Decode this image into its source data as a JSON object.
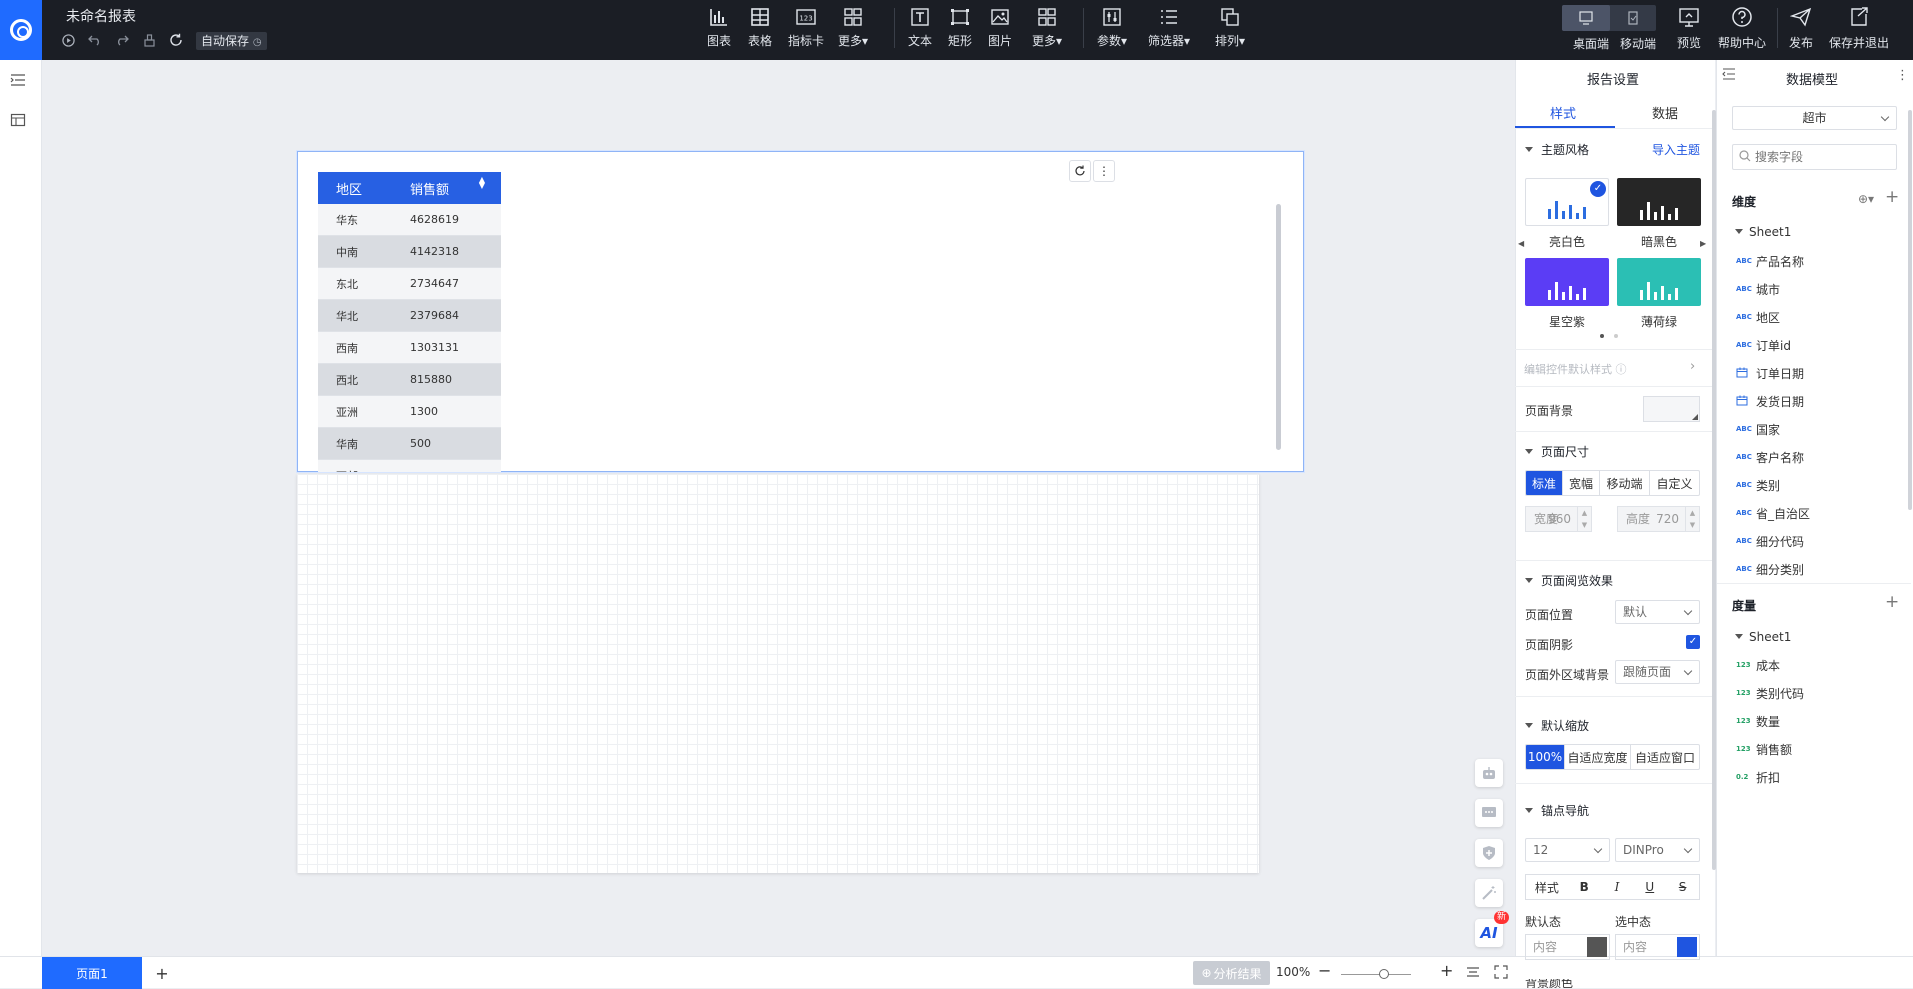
{
  "report_title": "未命名报表",
  "autosave_label": "自动保存",
  "toolbar": {
    "chart": "图表",
    "table": "表格",
    "kpi": "指标卡",
    "more1": "更多",
    "text": "文本",
    "rect": "矩形",
    "image": "图片",
    "more2": "更多",
    "param": "参数",
    "filter": "筛选器",
    "arrange": "排列",
    "kpi_icon_text": "123"
  },
  "right_toolbar": {
    "desktop": "桌面端",
    "mobile": "移动端",
    "preview": "预览",
    "help": "帮助中心",
    "publish": "发布",
    "save_exit": "保存并退出"
  },
  "table": {
    "headers": [
      "地区",
      "销售额"
    ],
    "rows": [
      [
        "华东",
        "4628619"
      ],
      [
        "中南",
        "4142318"
      ],
      [
        "东北",
        "2734647"
      ],
      [
        "华北",
        "2379684"
      ],
      [
        "西南",
        "1303131"
      ],
      [
        "西北",
        "815880"
      ],
      [
        "亚洲",
        "1300"
      ],
      [
        "华南",
        "500"
      ],
      [
        "西部",
        ""
      ]
    ]
  },
  "bottom": {
    "page_tab": "页面1",
    "add": "+",
    "analysis": "分析结果",
    "zoom": "100%",
    "zoom_minus": "−",
    "zoom_plus": "+"
  },
  "ai_badge": "新",
  "ai_label": "AI",
  "report_settings": {
    "title": "报告设置",
    "tab_style": "样式",
    "tab_data": "数据",
    "theme_section": "主题风格",
    "import_theme": "导入主题",
    "themes": [
      {
        "name": "亮白色",
        "color": "#ffffff",
        "bar": "#2c6de0"
      },
      {
        "name": "暗黑色",
        "color": "#262626",
        "bar": "#ffffff"
      },
      {
        "name": "星空紫",
        "color": "#5b3df5",
        "bar": "#ffffff"
      },
      {
        "name": "薄荷绿",
        "color": "#2bbfb4",
        "bar": "#ffffff"
      }
    ],
    "edit_default": "编辑控件默认样式",
    "page_bg": "页面背景",
    "page_size_section": "页面尺寸",
    "size_options": [
      "标准",
      "宽幅",
      "移动端",
      "自定义"
    ],
    "width_label": "宽度",
    "width_val": "960",
    "height_label": "高度",
    "height_val": "720",
    "view_section": "页面阅览效果",
    "page_pos": "页面位置",
    "page_pos_val": "默认",
    "page_shadow": "页面阴影",
    "outside_bg": "页面外区域背景",
    "outside_bg_val": "跟随页面",
    "zoom_section": "默认缩放",
    "zoom_options": [
      "100%",
      "自适应宽度",
      "自适应窗口"
    ],
    "anchor_section": "锚点导航",
    "font_size": "12",
    "font_family": "DINPro",
    "style_label": "样式",
    "bold": "B",
    "italic": "I",
    "underline": "U",
    "strike": "S",
    "default_state": "默认态",
    "selected_state": "选中态",
    "content": "内容",
    "bg_color": "背景颜色"
  },
  "data_model": {
    "title": "数据模型",
    "dataset": "超市",
    "search_placeholder": "搜索字段",
    "dim_title": "维度",
    "dim_sheet": "Sheet1",
    "dimensions": [
      {
        "type": "ABC",
        "name": "产品名称"
      },
      {
        "type": "ABC",
        "name": "城市"
      },
      {
        "type": "ABC",
        "name": "地区"
      },
      {
        "type": "ABC",
        "name": "订单id"
      },
      {
        "type": "date",
        "name": "订单日期"
      },
      {
        "type": "date",
        "name": "发货日期"
      },
      {
        "type": "ABC",
        "name": "国家"
      },
      {
        "type": "ABC",
        "name": "客户名称"
      },
      {
        "type": "ABC",
        "name": "类别"
      },
      {
        "type": "ABC",
        "name": "省_自治区"
      },
      {
        "type": "ABC",
        "name": "细分代码"
      },
      {
        "type": "ABC",
        "name": "细分类别"
      }
    ],
    "mea_title": "度量",
    "mea_sheet": "Sheet1",
    "measures": [
      {
        "type": "123",
        "name": "成本"
      },
      {
        "type": "123",
        "name": "类别代码"
      },
      {
        "type": "123",
        "name": "数量"
      },
      {
        "type": "123",
        "name": "销售额"
      },
      {
        "type": "0.2",
        "name": "折扣"
      }
    ]
  },
  "colors": {
    "accent": "#1f6bff",
    "topbar": "#1b1e25",
    "table_header": "#2760e3"
  }
}
